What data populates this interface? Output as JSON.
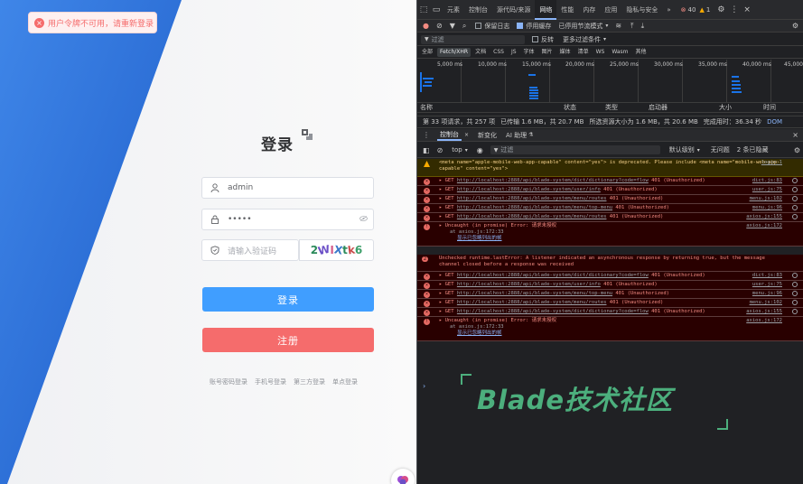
{
  "login": {
    "toast": "用户令牌不可用，请重新登录",
    "title": "登录",
    "username_value": "admin",
    "password_value": "•••••",
    "captcha_placeholder": "请输入验证码",
    "captcha_text": [
      "2",
      "W",
      "I",
      "X",
      "t",
      "k",
      "6"
    ],
    "login_button": "登录",
    "register_button": "注册",
    "links": [
      "账号密码登录",
      "手机号登录",
      "第三方登录",
      "单点登录"
    ],
    "colors": {
      "primary": "#409eff",
      "danger": "#f56c6c",
      "panel_blue": "#2d6fd6"
    }
  },
  "devtools": {
    "tabs": [
      "元素",
      "控制台",
      "源代码/来源",
      "网络",
      "性能",
      "内存",
      "应用",
      "隐私与安全"
    ],
    "active_tab": "网络",
    "more_tabs": "»",
    "error_count": "40",
    "warning_count": "1",
    "network_toolbar": {
      "preserve_log": "保留日志",
      "disable_cache": "停用缓存",
      "throttle": "已停用节流模式"
    },
    "filter_placeholder": "过滤",
    "invert_label": "反转",
    "more_filters": "更多过滤条件",
    "type_chips": [
      "全部",
      "Fetch/XHR",
      "文档",
      "CSS",
      "JS",
      "字体",
      "图片",
      "媒体",
      "清单",
      "WS",
      "Wasm",
      "其他"
    ],
    "active_chip": "Fetch/XHR",
    "timeline_ticks": [
      "5,000 ms",
      "10,000 ms",
      "15,000 ms",
      "20,000 ms",
      "25,000 ms",
      "30,000 ms",
      "35,000 ms",
      "40,000 ms",
      "45,000"
    ],
    "columns": [
      "名称",
      "状态",
      "类型",
      "启动器",
      "大小",
      "时间"
    ],
    "summary": [
      "第 33 项请求，共 257 项",
      "已传输 1.6 MB，共 20.7 MB",
      "所选资源大小为 1.6 MB，共 20.6 MB",
      "完成用时：36.34 秒",
      "DOM"
    ],
    "console_tabs": [
      "控制台",
      "新变化",
      "AI 助理"
    ],
    "active_console_tab": "控制台",
    "console_context": "top",
    "console_filter_placeholder": "过滤",
    "log_level": "默认级别",
    "issues": "无问题",
    "hidden_count": "2 条已隐藏",
    "warning_message": "<meta name=\"apple-mobile-web-app-capable\" content=\"yes\"> is deprecated. Please include <meta name=\"mobile-web-app-capable\" content=\"yes\">",
    "warning_source": "login:1",
    "logs_group1": [
      {
        "method": "GET",
        "url": "http://localhost:2888/api/blade-system/dict/dictionary?code=flow",
        "status": "401 (Unauthorized)",
        "src": "dict.js:83"
      },
      {
        "method": "GET",
        "url": "http://localhost:2888/api/blade-system/user/info",
        "status": "401 (Unauthorized)",
        "src": "user.js:75"
      },
      {
        "method": "GET",
        "url": "http://localhost:2888/api/blade-system/menu/routes",
        "status": "401 (Unauthorized)",
        "src": "menu.js:102"
      },
      {
        "method": "GET",
        "url": "http://localhost:2888/api/blade-system/menu/top-menu",
        "status": "401 (Unauthorized)",
        "src": "menu.js:96"
      },
      {
        "method": "GET",
        "url": "http://localhost:2888/api/blade-system/menu/routes",
        "status": "401 (Unauthorized)",
        "src": "axios.js:155"
      }
    ],
    "uncaught1": {
      "line1": "Uncaught (in promise) Error: 请求未授权",
      "line2": "at axios.js:172:33",
      "line3": "显示已忽略列出的帧",
      "src": "axios.js:172"
    },
    "runtime_badge": "2",
    "runtime_message": "Unchecked runtime.lastError: A listener indicated an asynchronous response by returning true, but the message channel closed before a response was received",
    "logs_group2": [
      {
        "method": "GET",
        "url": "http://localhost:2888/api/blade-system/dict/dictionary?code=flow",
        "status": "401 (Unauthorized)",
        "src": "dict.js:83"
      },
      {
        "method": "GET",
        "url": "http://localhost:2888/api/blade-system/user/info",
        "status": "401 (Unauthorized)",
        "src": "user.js:75"
      },
      {
        "method": "GET",
        "url": "http://localhost:2888/api/blade-system/menu/top-menu",
        "status": "401 (Unauthorized)",
        "src": "menu.js:96"
      },
      {
        "method": "GET",
        "url": "http://localhost:2888/api/blade-system/menu/routes",
        "status": "401 (Unauthorized)",
        "src": "menu.js:102"
      },
      {
        "method": "GET",
        "url": "http://localhost:2888/api/blade-system/dict/dictionary?code=flow",
        "status": "401 (Unauthorized)",
        "src": "axios.js:155"
      }
    ],
    "uncaught2": {
      "line1": "Uncaught (in promise) Error: 请求未授权",
      "line2": "at axios.js:172:33",
      "line3": "显示已忽略列出的帧",
      "src": "axios.js:172"
    },
    "prompt": "›"
  },
  "watermark": {
    "text": "Blade技术社区",
    "color": "#4caf7d"
  }
}
